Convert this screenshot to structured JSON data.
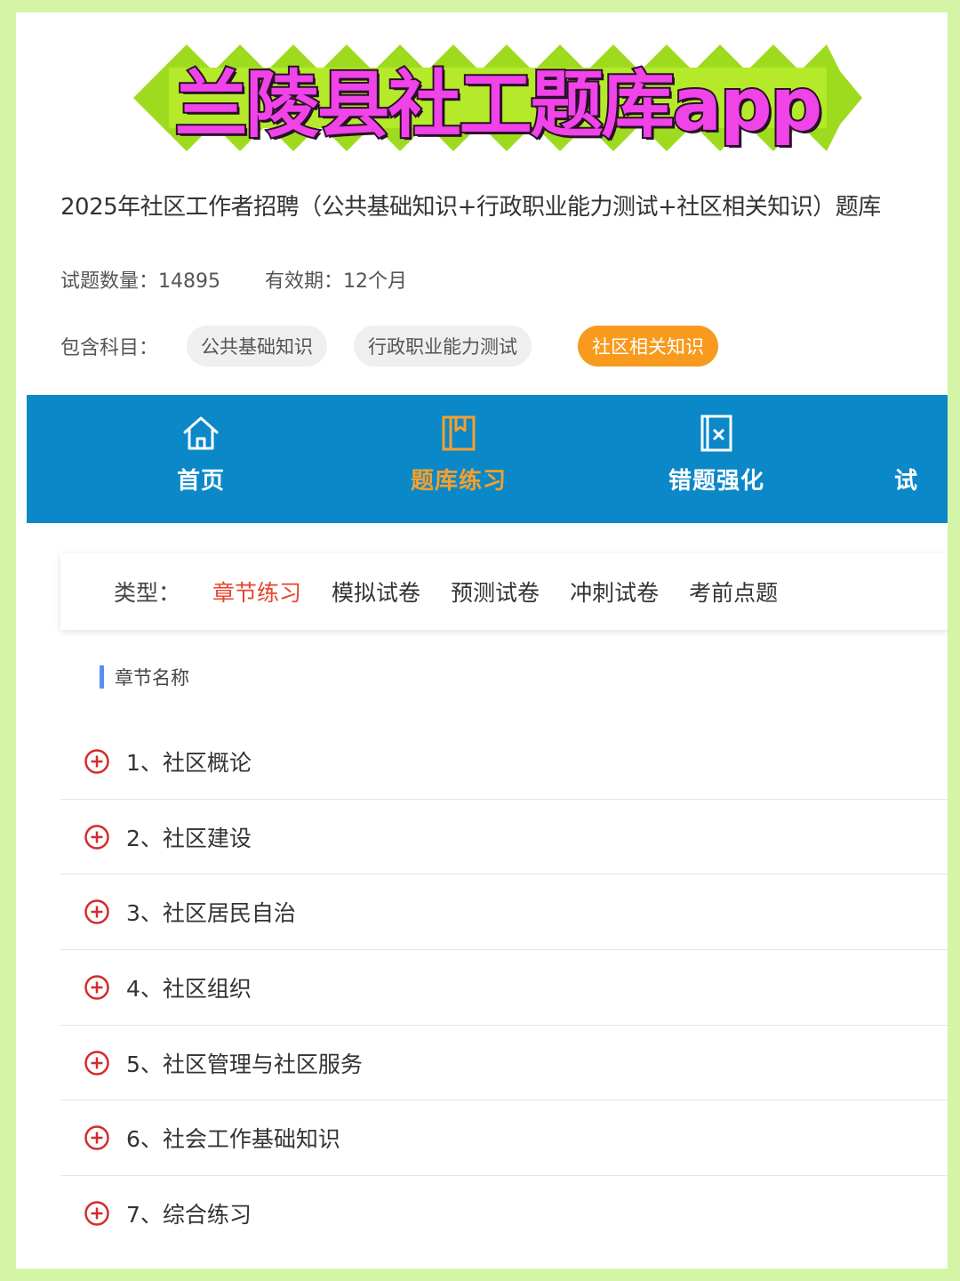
{
  "headline": "兰陵县社工题库app",
  "product": {
    "title": "2025年社区工作者招聘（公共基础知识+行政职业能力测试+社区相关知识）题库",
    "question_count_label": "试题数量：",
    "question_count": "14895",
    "validity_label": "有效期：",
    "validity": "12个月",
    "subjects_label": "包含科目：",
    "subjects": [
      "公共基础知识",
      "行政职业能力测试",
      "社区相关知识"
    ],
    "active_subject": "社区相关知识"
  },
  "nav": {
    "items": [
      {
        "label": "首页",
        "icon": "home-icon"
      },
      {
        "label": "题库练习",
        "icon": "book-icon"
      },
      {
        "label": "错题强化",
        "icon": "wrong-answer-icon"
      },
      {
        "label": "试",
        "icon": ""
      }
    ],
    "active": "题库练习"
  },
  "types": {
    "label": "类型：",
    "tabs": [
      "章节练习",
      "模拟试卷",
      "预测试卷",
      "冲刺试卷",
      "考前点题"
    ],
    "active": "章节练习"
  },
  "chapters": {
    "heading": "章节名称",
    "items": [
      "1、社区概论",
      "2、社区建设",
      "3、社区居民自治",
      "4、社区组织",
      "5、社区管理与社区服务",
      "6、社会工作基础知识",
      "7、综合练习"
    ]
  },
  "colors": {
    "background": "#d4f5a8",
    "nav_blue": "#0a88c8",
    "accent_orange": "#f79a1e",
    "tab_red": "#e8432e",
    "headline_pink": "#f044e8",
    "banner_green": "#9edb1e"
  }
}
